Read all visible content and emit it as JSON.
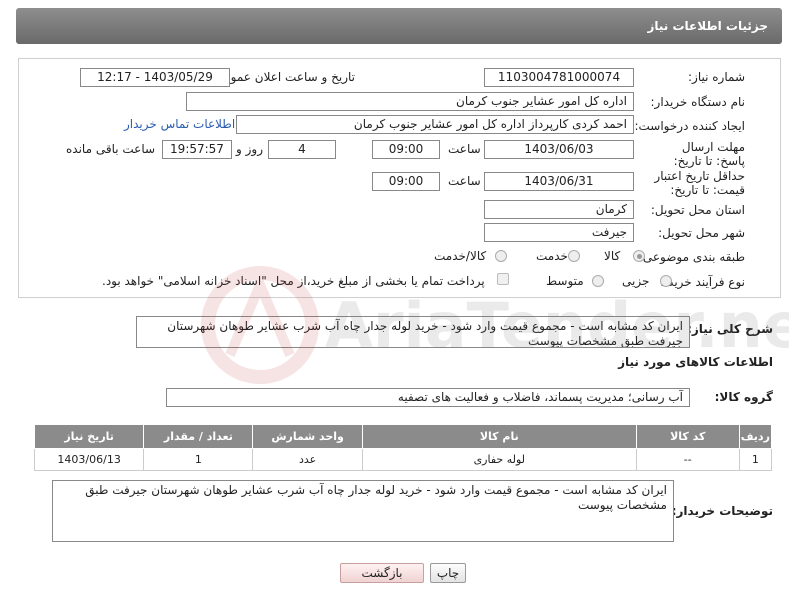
{
  "header": {
    "title": "جزئیات اطلاعات نیاز"
  },
  "form": {
    "need_number": {
      "label": "شماره نیاز:",
      "value": "1103004781000074"
    },
    "announce_datetime": {
      "label": "تاریخ و ساعت اعلان عمومی:",
      "value": "1403/05/29 - 12:17"
    },
    "buyer_org": {
      "label": "نام دستگاه خریدار:",
      "value": "اداره کل امور عشایر جنوب کرمان"
    },
    "creator": {
      "label": "ایجاد کننده درخواست:",
      "value": "احمد کردی    کارپرداز اداره کل امور عشایر جنوب کرمان",
      "contact_link": "اطلاعات تماس خریدار"
    },
    "reply_deadline": {
      "label": "مهلت ارسال پاسخ: تا تاریخ:",
      "date": "1403/06/03",
      "time_label": "ساعت",
      "time": "09:00",
      "days": "4",
      "days_label": "روز و",
      "remaining": "19:57:57",
      "remaining_label": "ساعت باقی مانده"
    },
    "price_validity": {
      "label": "حداقل تاریخ اعتبار قیمت: تا تاریخ:",
      "date": "1403/06/31",
      "time_label": "ساعت",
      "time": "09:00"
    },
    "province": {
      "label": "استان محل تحویل:",
      "value": "کرمان"
    },
    "city": {
      "label": "شهر محل تحویل:",
      "value": "جیرفت"
    },
    "category": {
      "label": "طبقه بندی موضوعی:",
      "options": [
        "کالا",
        "خدمت",
        "کالا/خدمت"
      ],
      "selected": "کالا"
    },
    "purchase_type": {
      "label": "نوع فرآیند خرید :",
      "options": [
        "جزیی",
        "متوسط"
      ],
      "selected": "جزیی",
      "payment_note": "پرداخت تمام یا بخشی از مبلغ خرید،از محل \"اسناد خزانه اسلامی\" خواهد بود."
    }
  },
  "summary": {
    "label": "شرح کلی نیاز:",
    "text": "ایران کد مشابه است - مجموع قیمت وارد شود - خرید  لوله جدار چاه آب  شرب عشایر  طوهان شهرستان جیرفت طبق مشخصات پیوست"
  },
  "goods_section": {
    "title": "اطلاعات کالاهای مورد نیاز"
  },
  "goods_group": {
    "label": "گروه کالا:",
    "value": "آب رسانی؛ مدیریت پسماند، فاضلاب و فعالیت های تصفیه"
  },
  "table": {
    "headers": [
      "ردیف",
      "کد کالا",
      "نام کالا",
      "واحد شمارش",
      "تعداد / مقدار",
      "تاریخ نیاز"
    ],
    "rows": [
      [
        "1",
        "--",
        "لوله حفاری",
        "عدد",
        "1",
        "1403/06/13"
      ]
    ]
  },
  "buyer_notes": {
    "label": "توضیحات خریدار:",
    "text": "ایران کد مشابه است - مجموع قیمت وارد شود - خرید  لوله جدار چاه آب  شرب عشایر  طوهان شهرستان جیرفت طبق مشخصات پیوست"
  },
  "buttons": {
    "print": "چاپ",
    "back": "بازگشت"
  },
  "watermark_text": "AriaTender.neT",
  "colors": {
    "header_bg": "#7a7a7a",
    "link": "#2a5db0",
    "table_header": "#8b8b8b",
    "back_button": "#f0d2d2"
  }
}
